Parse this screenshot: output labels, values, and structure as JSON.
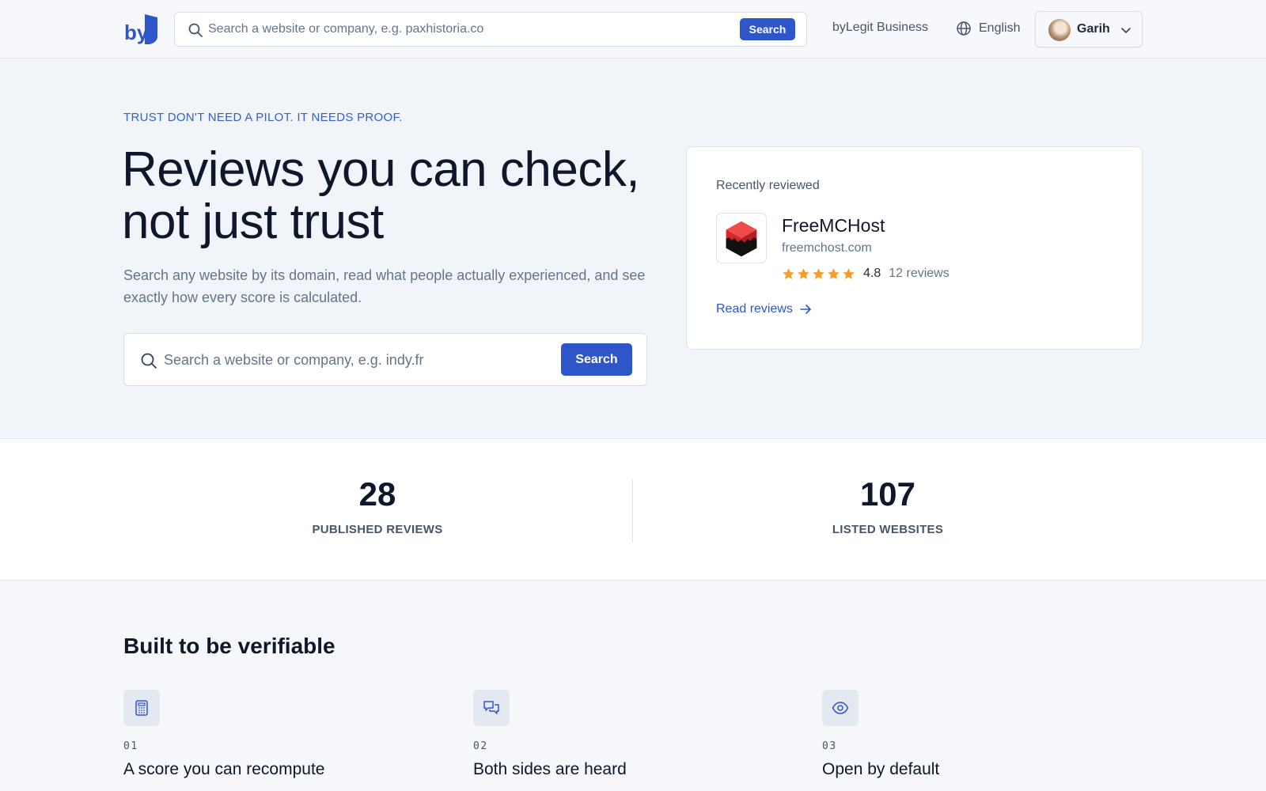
{
  "colors": {
    "accent": "#2f56c9",
    "star": "#f59e2b",
    "text": "#0f172a",
    "muted": "#64748b",
    "background": "#f1f4f9"
  },
  "header": {
    "logo_text": "by",
    "search_placeholder": "Search a website or company, e.g. paxhistoria.co",
    "search_button": "Search",
    "business_link": "byLegit Business",
    "language": "English",
    "language_icon": "globe-icon",
    "user_name": "Garih"
  },
  "hero": {
    "eyebrow": "TRUST DON'T NEED A PILOT. IT NEEDS PROOF.",
    "title": "Reviews you can check, not just trust",
    "subtitle": "Search any website by its domain, read what people actually experienced, and see exactly how every score is calculated.",
    "search_placeholder": "Search a website or company, e.g. indy.fr",
    "search_button": "Search"
  },
  "recent": {
    "label": "Recently reviewed",
    "site_name": "FreeMCHost",
    "site_domain": "freemchost.com",
    "stars": 5,
    "rating": "4.8",
    "review_count": "12 reviews",
    "link": "Read reviews"
  },
  "stats": [
    {
      "value": "28",
      "label": "PUBLISHED REVIEWS"
    },
    {
      "value": "107",
      "label": "LISTED WEBSITES"
    }
  ],
  "features": {
    "title": "Built to be verifiable",
    "items": [
      {
        "num": "01",
        "title": "A score you can recompute",
        "icon": "calculator-icon"
      },
      {
        "num": "02",
        "title": "Both sides are heard",
        "icon": "chat-bubbles-icon"
      },
      {
        "num": "03",
        "title": "Open by default",
        "icon": "eye-icon"
      }
    ]
  }
}
